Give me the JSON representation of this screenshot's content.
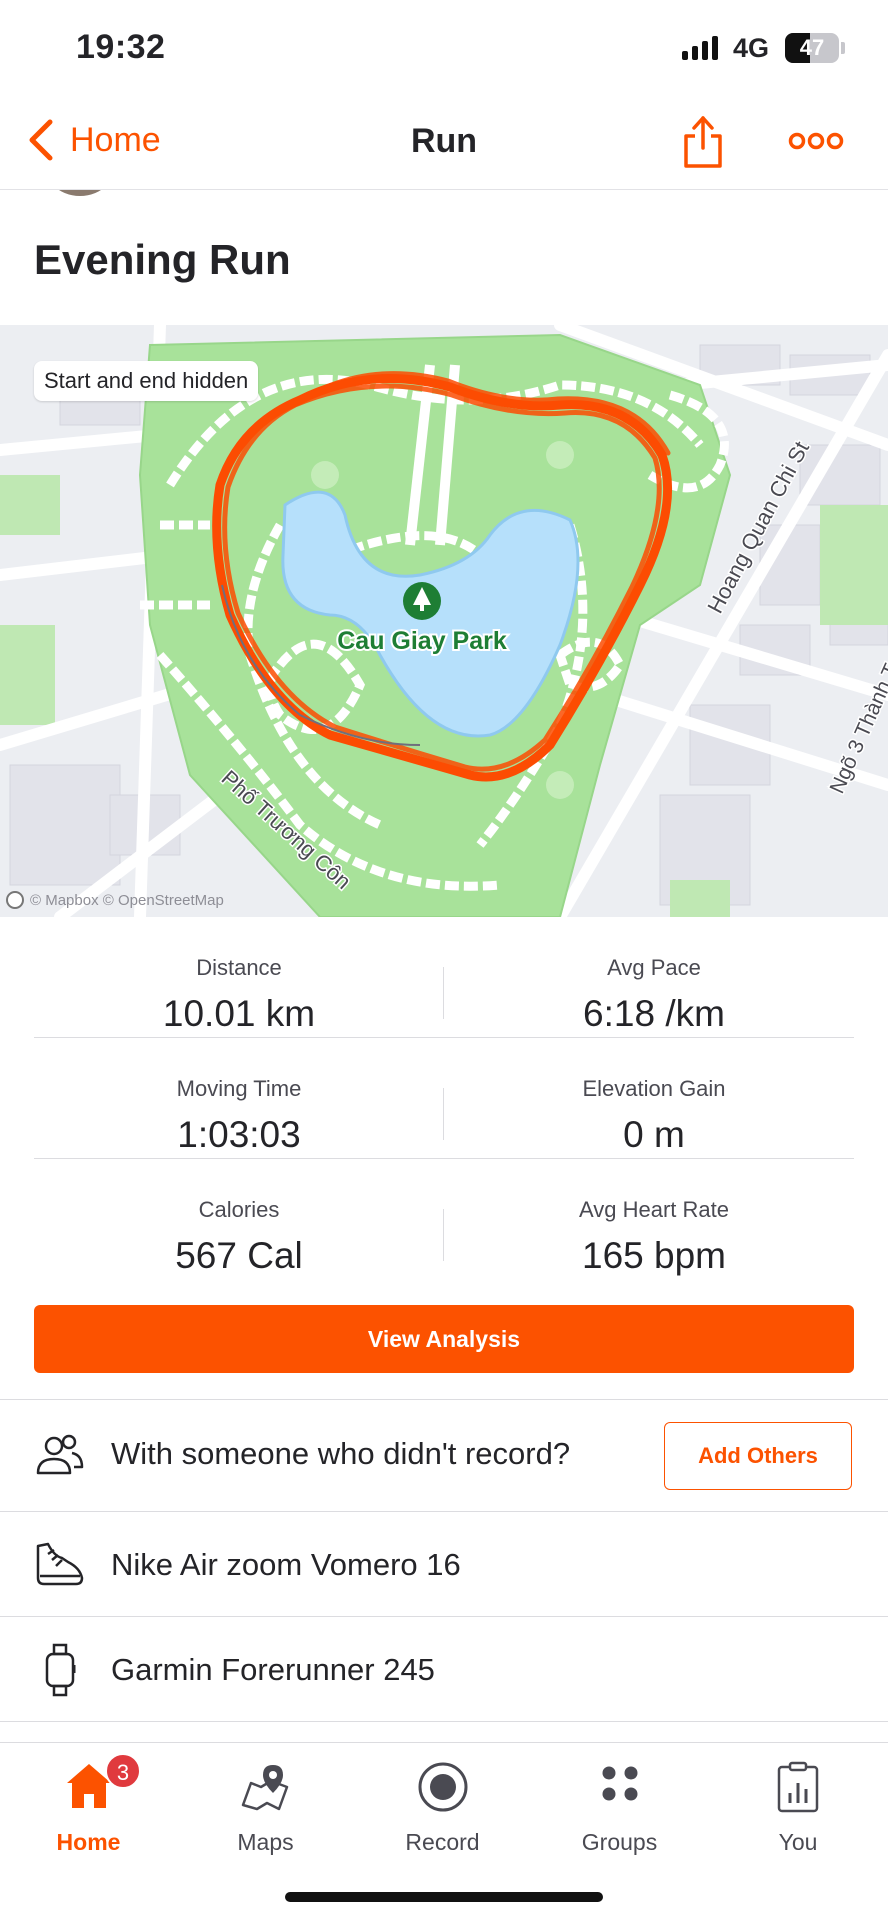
{
  "status_bar": {
    "time": "19:32",
    "network": "4G",
    "battery": "47",
    "battery_level_percent": 47
  },
  "navbar": {
    "back_label": "Home",
    "title": "Run",
    "accent_color": "#fc5200"
  },
  "activity": {
    "title": "Evening Run"
  },
  "map": {
    "privacy_chip": "Start and end hidden",
    "park_label": "Cau Giay Park",
    "street_labels": [
      "Hoang Quan Chi St",
      "Phố Trương Côn",
      "Ngõ 3 Thành T"
    ],
    "attribution": "© Mapbox © OpenStreetMap",
    "route_color": "#fc4c02",
    "park_color": "#a8e29a",
    "water_color": "#b6e0fb"
  },
  "stats": [
    {
      "label": "Distance",
      "value": "10.01 km"
    },
    {
      "label": "Avg Pace",
      "value": "6:18 /km"
    },
    {
      "label": "Moving Time",
      "value": "1:03:03"
    },
    {
      "label": "Elevation Gain",
      "value": "0 m"
    },
    {
      "label": "Calories",
      "value": "567 Cal"
    },
    {
      "label": "Avg Heart Rate",
      "value": "165 bpm"
    }
  ],
  "actions": {
    "view_analysis": "View Analysis",
    "with_someone": "With someone who didn't record?",
    "add_others": "Add Others"
  },
  "gear": {
    "shoe": "Nike Air zoom Vomero 16",
    "device": "Garmin Forerunner 245"
  },
  "tabbar": {
    "items": [
      {
        "label": "Home",
        "icon": "home-icon",
        "active": true,
        "badge": "3"
      },
      {
        "label": "Maps",
        "icon": "maps-icon",
        "active": false
      },
      {
        "label": "Record",
        "icon": "record-icon",
        "active": false
      },
      {
        "label": "Groups",
        "icon": "groups-icon",
        "active": false
      },
      {
        "label": "You",
        "icon": "you-icon",
        "active": false
      }
    ]
  }
}
